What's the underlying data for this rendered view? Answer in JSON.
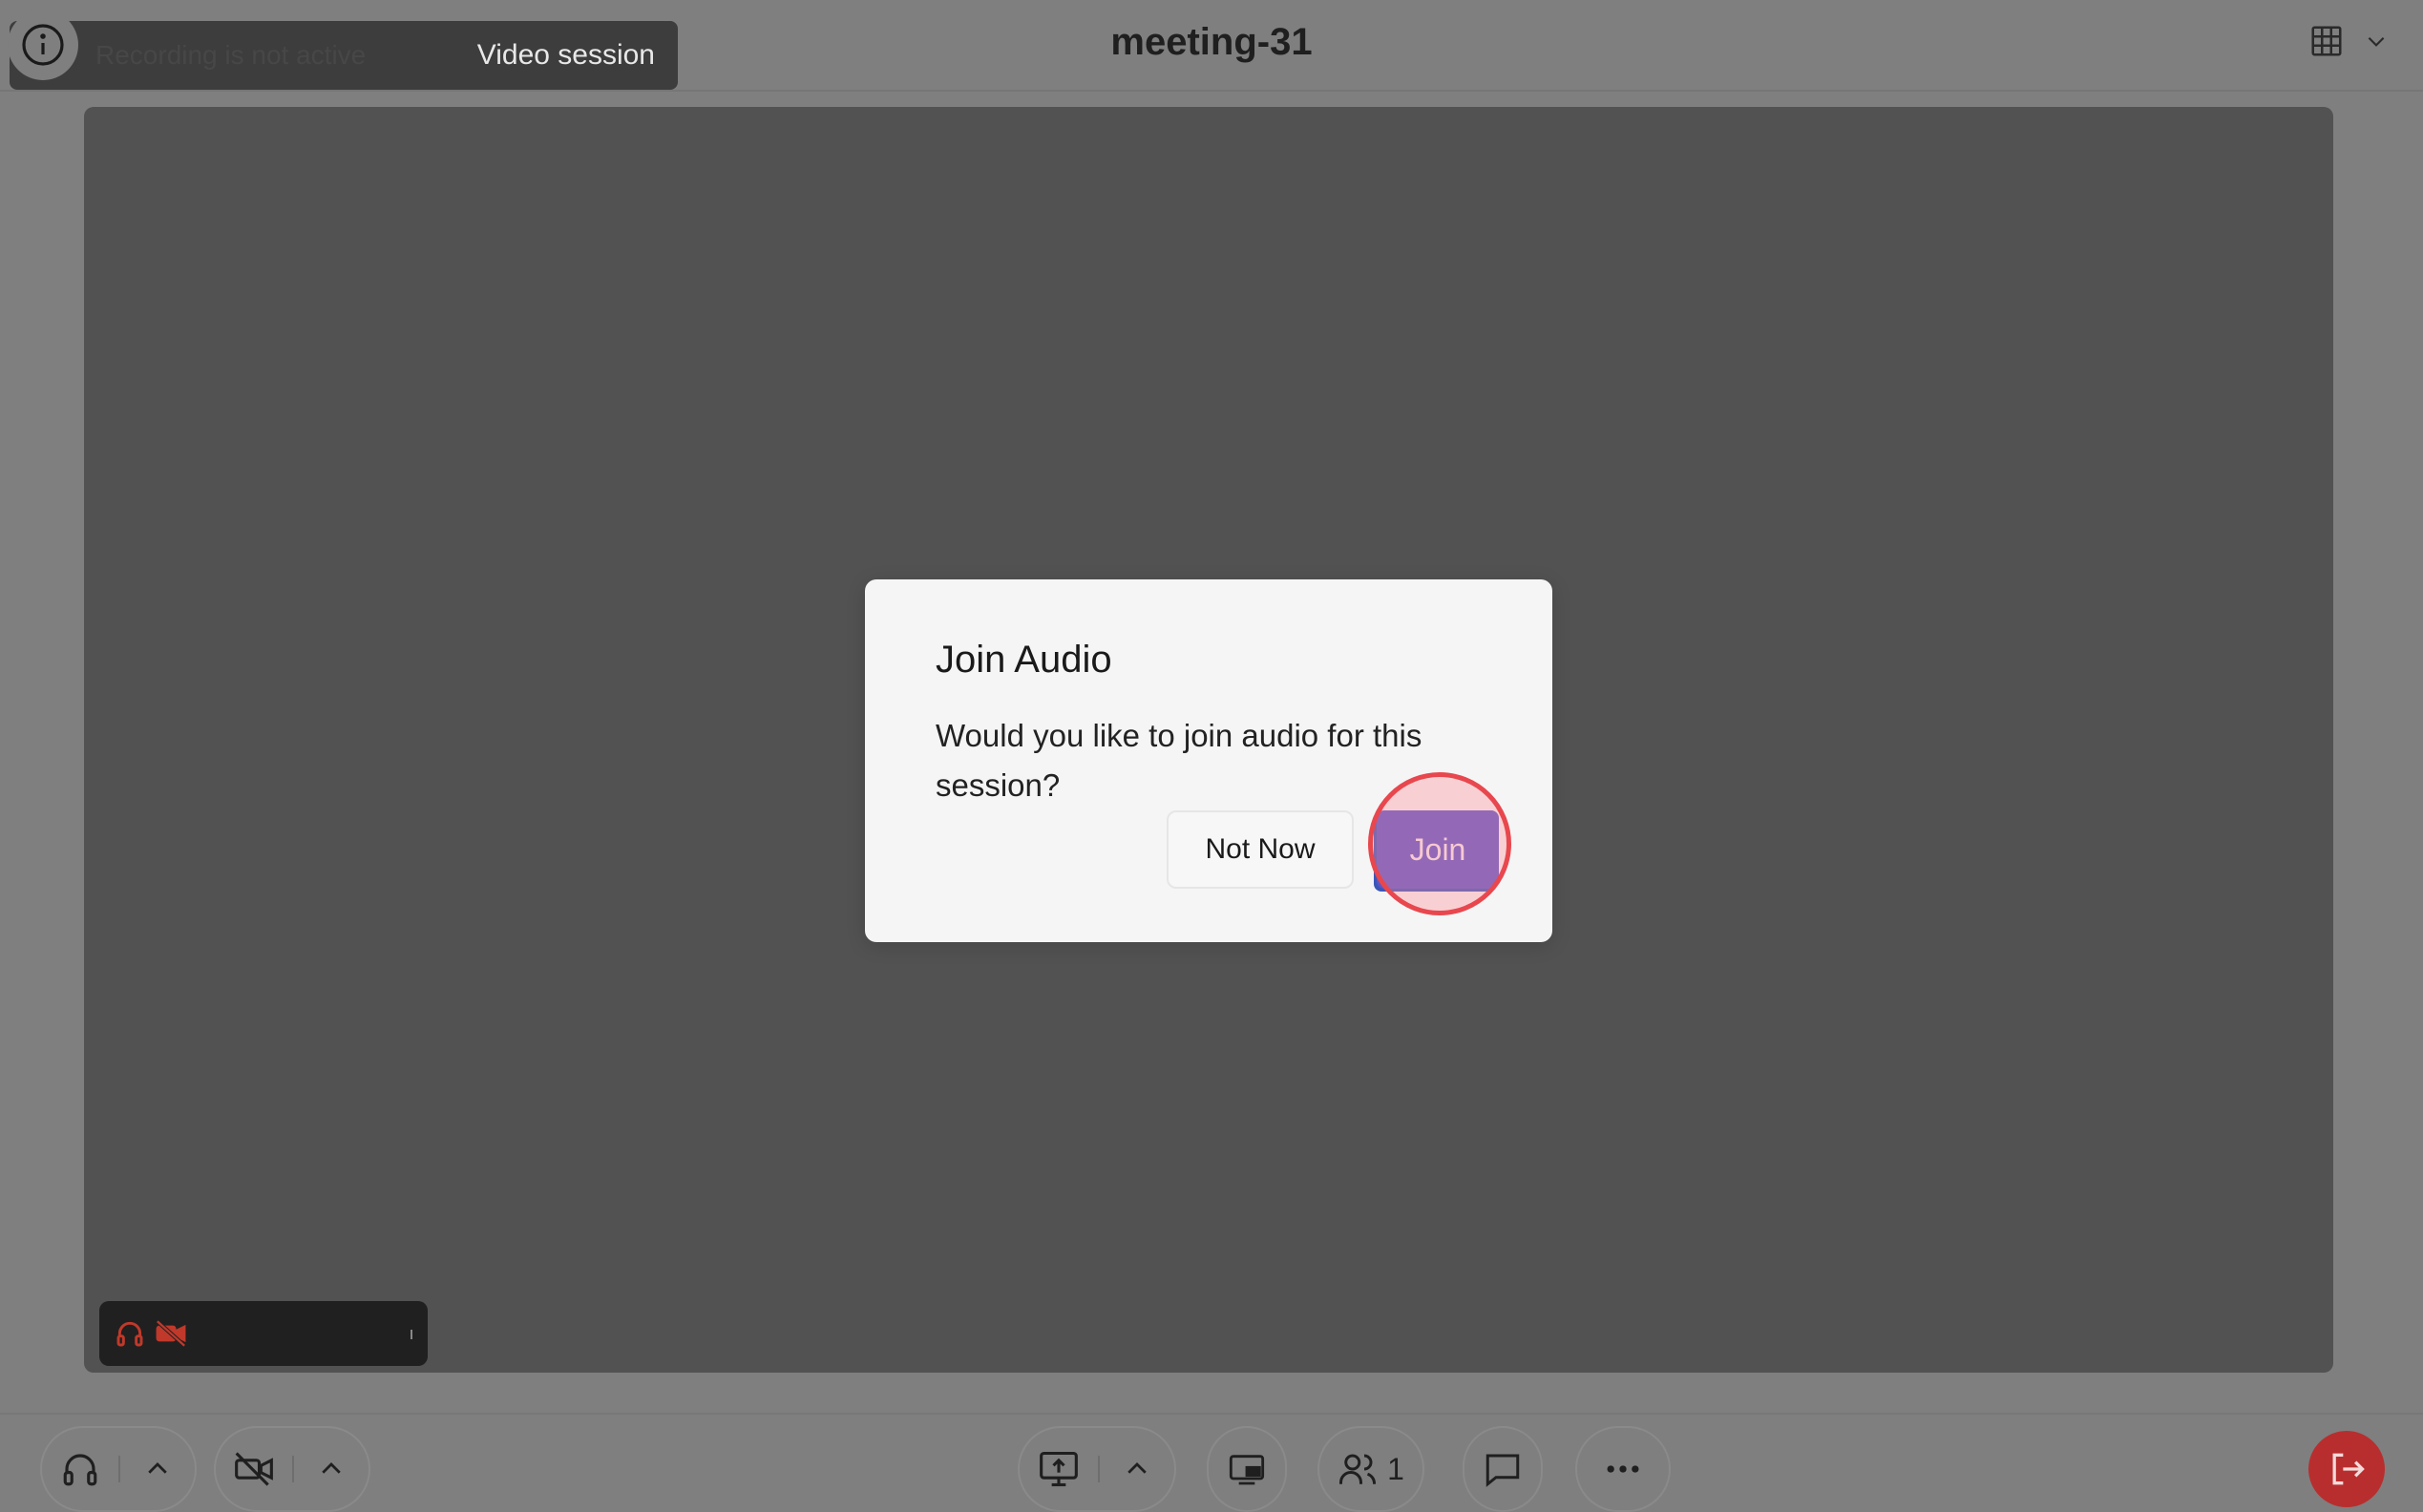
{
  "header": {
    "hidden_session_text": "Recording is not active",
    "session_label": "Video session",
    "title": "meeting-31"
  },
  "modal": {
    "title": "Join Audio",
    "body": "Would you like to join audio for this session?",
    "not_now_label": "Not Now",
    "join_label": "Join"
  },
  "footer": {
    "participants_count": "1"
  },
  "colors": {
    "background": "#7f7f7f",
    "video_stage": "#525252",
    "join_button": "#5a56c9",
    "leave_button": "#b82e2e",
    "muted_indicator": "#c0392b"
  },
  "icons": {
    "info": "info-icon",
    "layout": "grid-icon",
    "audio": "headphones-icon",
    "video": "video-off-icon",
    "share": "screen-share-icon",
    "pip": "picture-in-picture-icon",
    "participants": "participants-icon",
    "chat": "chat-icon",
    "more": "more-icon",
    "leave": "leave-icon"
  }
}
